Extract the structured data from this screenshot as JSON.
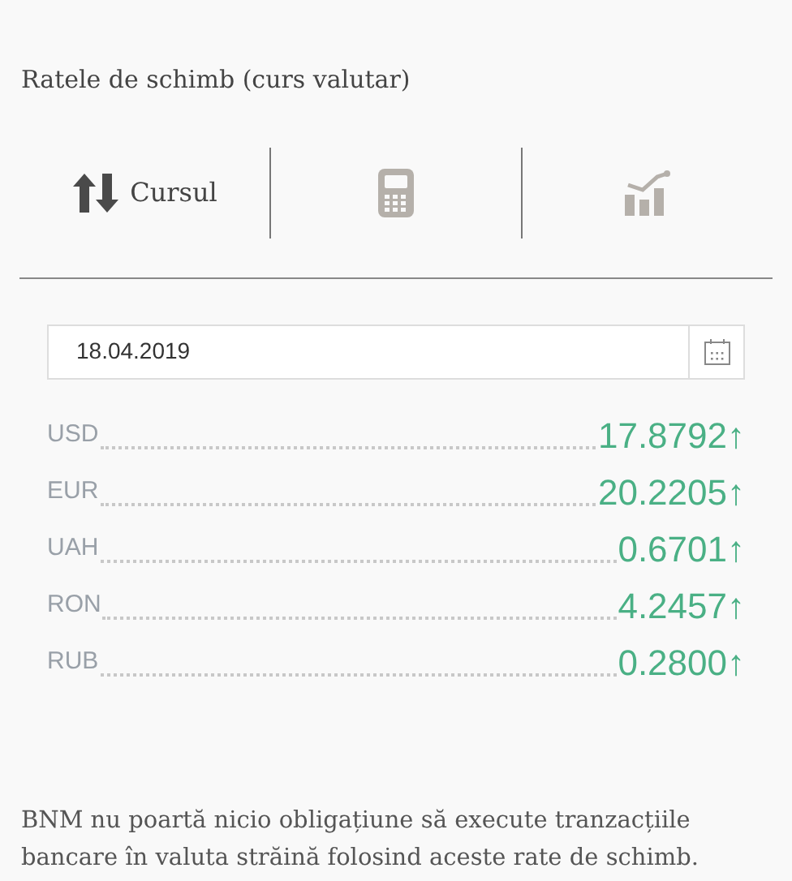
{
  "title": "Ratele de schimb (curs valutar)",
  "tabs": [
    {
      "kind": "exchange",
      "label": "Cursul",
      "selected": true
    },
    {
      "kind": "calculator",
      "selected": false
    },
    {
      "kind": "chart",
      "selected": false
    }
  ],
  "date_field": {
    "value": "18.04.2019"
  },
  "rates": [
    {
      "currency": "USD",
      "value": "17.8792",
      "arrow": "↑"
    },
    {
      "currency": "EUR",
      "value": "20.2205",
      "arrow": "↑"
    },
    {
      "currency": "UAH",
      "value": "0.6701",
      "arrow": "↑"
    },
    {
      "currency": "RON",
      "value": "4.2457",
      "arrow": "↑"
    },
    {
      "currency": "RUB",
      "value": "0.2800",
      "arrow": "↑"
    }
  ],
  "disclaimer": "BNM nu poartă nicio obligațiune să execute tranzacțiile bancare în valuta străină folosind aceste rate de schimb."
}
